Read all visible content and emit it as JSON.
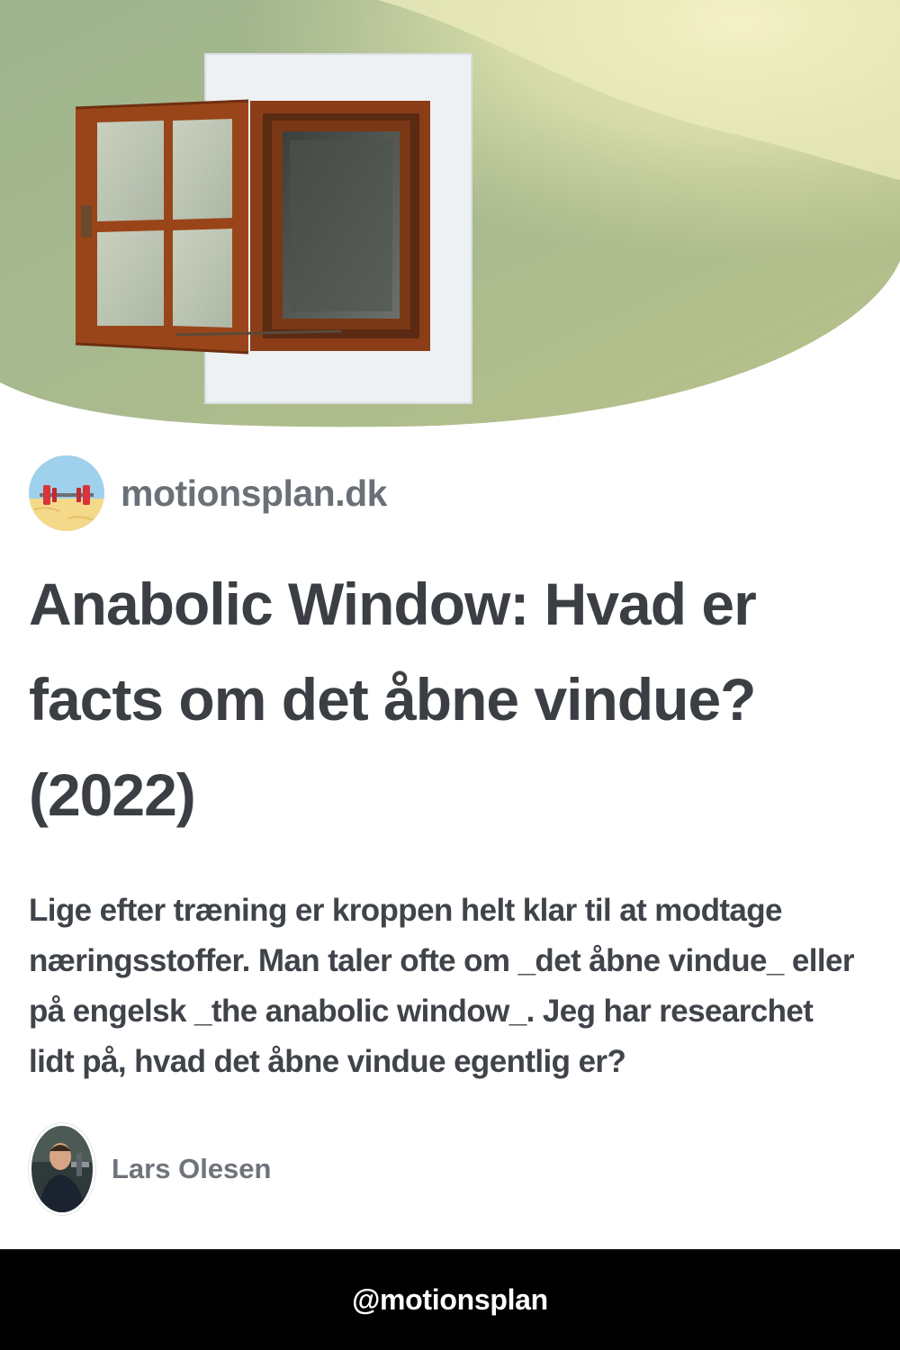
{
  "hero": {
    "image": "open-wooden-window-on-green-wall"
  },
  "site": {
    "logo": "dumbbell-on-beach-icon",
    "name": "motionsplan.dk"
  },
  "article": {
    "title_lines": [
      "Anabolic Window: Hvad er",
      "facts om det åbne vindue?",
      "(2022)"
    ],
    "excerpt_lines": [
      "Lige efter træning er kroppen helt klar til at modtage",
      "næringsstoffer. Man taler ofte om _det åbne vindue_ eller",
      "på engelsk _the anabolic window_. Jeg har researchet",
      "lidt på, hvad det åbne vindue egentlig er?"
    ]
  },
  "author": {
    "name": "Lars Olesen"
  },
  "footer": {
    "handle": "@motionsplan"
  }
}
